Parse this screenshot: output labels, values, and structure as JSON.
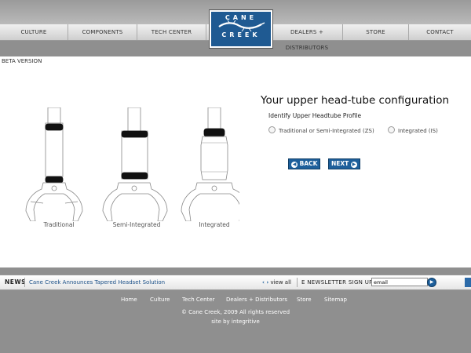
{
  "nav": {
    "items": [
      "CULTURE",
      "COMPONENTS",
      "TECH CENTER",
      "DEALERS + DISTRIBUTORS",
      "STORE",
      "CONTACT"
    ]
  },
  "logo": {
    "line1": "CANE",
    "line2": "CREEK"
  },
  "main": {
    "beta_label": "BETA VERSION",
    "title": "Your upper head-tube configuration",
    "subtitle": "Identify Upper Headtube Profile",
    "options": [
      {
        "label": "Traditional or Semi-Integrated (ZS)",
        "selected": false
      },
      {
        "label": "Integrated (IS)",
        "selected": false
      }
    ],
    "back_label": "BACK",
    "next_label": "NEXT",
    "diagrams": [
      {
        "caption": "Traditional"
      },
      {
        "caption": "Semi-Integrated"
      },
      {
        "caption": "Integrated"
      }
    ]
  },
  "news": {
    "label": "NEWS",
    "headline": "Cane Creek Announces Tapered Headset Solution",
    "view_all": "view all",
    "newsletter": "E NEWSLETTER SIGN UP",
    "email_value": "email"
  },
  "footer": {
    "links": [
      "Home",
      "Culture",
      "Tech Center",
      "Dealers + Distributors",
      "Store",
      "Sitemap"
    ],
    "copyright": "© Cane Creek, 2009 All rights reserved",
    "credit": "site by integritive"
  },
  "colors": {
    "brand_blue": "#1d5f9b",
    "background_gray": "#8f8f8f"
  }
}
